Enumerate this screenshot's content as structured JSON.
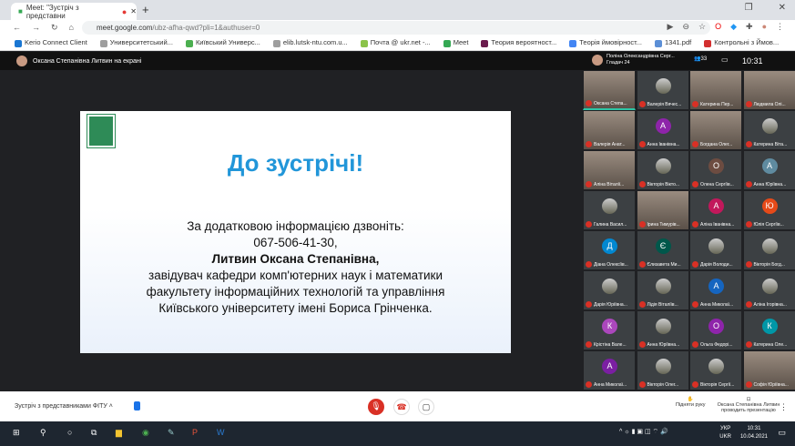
{
  "browser": {
    "tab_title": "Meet: \"Зустріч з представни",
    "url_host": "meet.google.com",
    "url_path": "/ubz-afha-qwd?pli=1&authuser=0",
    "bookmarks": [
      "Kerio Connect Client",
      "Университетський...",
      "Київський Универс...",
      "elib.lutsk-ntu.com.u...",
      "Почта @ ukr.net -...",
      "Meet",
      "Теория вероятност...",
      "Теорія ймовірност...",
      "1341.pdf",
      "Контрольні з Ймов..."
    ]
  },
  "meet": {
    "presenter_label": "Оксана Степанівна Литвин на екрані",
    "pinned_name": "Поліна Олександрівна Серг...",
    "pinned_sub": "Гладач 24",
    "participants_count": "33",
    "time": "10:31",
    "slide": {
      "title": "До зустрічі!",
      "lines": [
        "За додатковою інформацією дзвоніть:",
        "067-506-41-30,"
      ],
      "bold_line": "Литвин Оксана Степанівна,",
      "lines2": [
        "завідувач кафедри комп'ютерних наук і математики",
        "факультету інформаційних технологій та управління",
        "Київського університету імені Бориса Грінченка."
      ]
    },
    "tiles": [
      {
        "name": "Оксана Степа...",
        "kind": "video"
      },
      {
        "name": "Валерія Вячес...",
        "kind": "photo"
      },
      {
        "name": "Катерина Пер...",
        "kind": "video"
      },
      {
        "name": "Людмила Олі...",
        "kind": "video"
      },
      {
        "name": "Валерія Анат...",
        "kind": "video"
      },
      {
        "name": "Анна Іванівна...",
        "kind": "letter",
        "letter": "А",
        "color": "#8e24aa"
      },
      {
        "name": "Богдана Олег...",
        "kind": "video"
      },
      {
        "name": "Катерина Віта...",
        "kind": "photo"
      },
      {
        "name": "Аліна Віталії...",
        "kind": "video"
      },
      {
        "name": "Вікторія Вікто...",
        "kind": "photo"
      },
      {
        "name": "Олена Сергіїв...",
        "kind": "letter",
        "letter": "О",
        "color": "#6d4c41"
      },
      {
        "name": "Анна Юріївна...",
        "kind": "letter",
        "letter": "А",
        "color": "#5f8ba0"
      },
      {
        "name": "Галина Васил...",
        "kind": "photo"
      },
      {
        "name": "Ірина Тимурів...",
        "kind": "video"
      },
      {
        "name": "Аліна Іванівна...",
        "kind": "letter",
        "letter": "А",
        "color": "#c2185b"
      },
      {
        "name": "Юлія Сергіїв...",
        "kind": "letter",
        "letter": "Ю",
        "color": "#e64a19"
      },
      {
        "name": "Діана Олексіїв...",
        "kind": "letter",
        "letter": "Д",
        "color": "#0288d1"
      },
      {
        "name": "Єлизавета Ми...",
        "kind": "letter",
        "letter": "Є",
        "color": "#00574b"
      },
      {
        "name": "Дарія Володи...",
        "kind": "photo"
      },
      {
        "name": "Вікторія Богд...",
        "kind": "photo"
      },
      {
        "name": "Дарія Юріївна...",
        "kind": "photo"
      },
      {
        "name": "Лідія Віталіїв...",
        "kind": "photo"
      },
      {
        "name": "Анна Миколаї...",
        "kind": "letter",
        "letter": "А",
        "color": "#1565c0"
      },
      {
        "name": "Аліна Ігорівна...",
        "kind": "photo"
      },
      {
        "name": "Крістіна Вале...",
        "kind": "letter",
        "letter": "К",
        "color": "#ab47bc"
      },
      {
        "name": "Анна Юріївна...",
        "kind": "photo"
      },
      {
        "name": "Ольга Федорі...",
        "kind": "letter",
        "letter": "О",
        "color": "#8e24aa"
      },
      {
        "name": "Катерина Оле...",
        "kind": "letter",
        "letter": "К",
        "color": "#0097a7"
      },
      {
        "name": "Анна Миколаї...",
        "kind": "letter",
        "letter": "А",
        "color": "#7b1fa2"
      },
      {
        "name": "Вікторія Олег...",
        "kind": "photo"
      },
      {
        "name": "Вікторія Сергії...",
        "kind": "photo"
      },
      {
        "name": "Софія Юріївна...",
        "kind": "video"
      }
    ],
    "bottom": {
      "meeting_name": "Зустріч з представниками ФІТУ",
      "raise_hand": "Підняти руку",
      "present_line1": "Оксана Степанівна Литвин",
      "present_line2": "проводить презентацію"
    }
  },
  "taskbar": {
    "lang1": "УКР",
    "lang2": "UKR",
    "time": "10:31",
    "date": "10.04.2021"
  }
}
